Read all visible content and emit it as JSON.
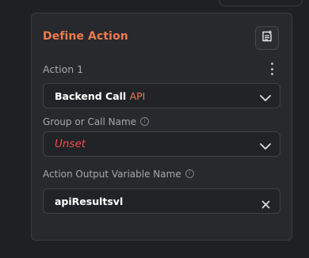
{
  "panel": {
    "title": "Define Action",
    "action_label": "Action 1",
    "action_type": {
      "value": "Backend Call",
      "tag": "API"
    },
    "group_label": "Group or Call Name",
    "group_value": "Unset",
    "output_label": "Action Output Variable Name",
    "output_value": "apiResultsvl"
  },
  "colors": {
    "accent": "#ef7a4f",
    "unset": "#ef4f4f",
    "card_bg": "#27292c",
    "page_bg": "#1f2023"
  },
  "icons": {
    "notes": "notes-add-icon",
    "more": "more-vertical-icon",
    "chevron": "chevron-down-icon",
    "info": "info-icon",
    "clear": "close-icon"
  }
}
